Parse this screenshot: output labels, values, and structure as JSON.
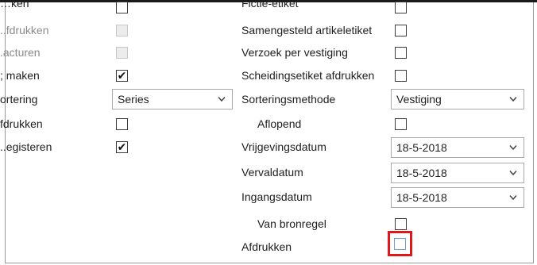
{
  "left_column": {
    "row0_label": "…ken",
    "rows": [
      {
        "label": "..fdrukken"
      },
      {
        "label": ".acturen"
      },
      {
        "label": "; maken"
      },
      {
        "label": "ortering"
      },
      {
        "label": "fdrukken"
      },
      {
        "label": "..egisteren"
      }
    ]
  },
  "left_sort_select": {
    "value": "Series"
  },
  "right_column": {
    "row0_label": "Fictie-etiket",
    "labels": [
      "Samengesteld artikeletiket",
      "Verzoek per vestiging",
      "Scheidingsetiket afdrukken",
      "Sorteringsmethode",
      "Aflopend",
      "Vrijgevingsdatum",
      "Vervaldatum",
      "Ingangsdatum",
      "Van bronregel",
      "Afdrukken"
    ]
  },
  "selects": {
    "sorteringsmethode": "Vestiging",
    "vrijgevingsdatum": "18-5-2018",
    "vervaldatum": "18-5-2018",
    "ingangsdatum": "18-5-2018"
  },
  "checks": {
    "left_row0": false,
    "afdrukken_1": false,
    "factureren": false,
    "maken": true,
    "afdrukken_2": false,
    "registreren": true,
    "right_row0": false,
    "samengesteld": false,
    "verzoek": false,
    "scheidingsetiket": false,
    "aflopend": false,
    "van_bronregel": false,
    "afdrukken_right": false
  },
  "colors": {
    "highlight": "#e01818",
    "focus": "#6e9fd0"
  },
  "icons": {
    "checkmark": "✔",
    "dropdown": "chevron-down-icon"
  }
}
